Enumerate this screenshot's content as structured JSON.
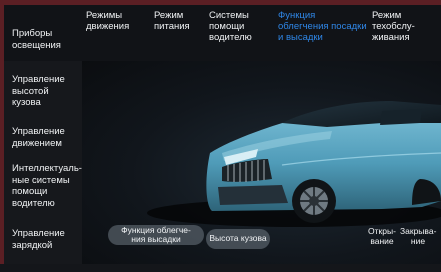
{
  "tabs": [
    {
      "label": "Режимы\nдвижения"
    },
    {
      "label": "Режим\nпитания"
    },
    {
      "label": "Системы\nпомощи\nводителю"
    },
    {
      "label": "Функция\nоблегчения посадки\nи высадки"
    },
    {
      "label": "Режим\nтехобслу-\nживания"
    }
  ],
  "sidebar": {
    "items": [
      {
        "label": "Приборы\nосвещения"
      },
      {
        "label": "Управление\nвысотой\nкузова"
      },
      {
        "label": "Управление\nдвижением"
      },
      {
        "label": "Интеллектуаль-\nные системы\nпомощи\nводителю"
      },
      {
        "label": "Управление\nзарядкой"
      }
    ]
  },
  "buttons": {
    "entry_exit": "Функция облегче-\nния высадки",
    "body_height": "Высота кузова",
    "open": "Откры-\nвание",
    "close": "Закрыва-\nние"
  },
  "colors": {
    "active_tab": "#2f86e6",
    "car_body": "#5aa9c4",
    "frame_red": "#5b1f24"
  }
}
